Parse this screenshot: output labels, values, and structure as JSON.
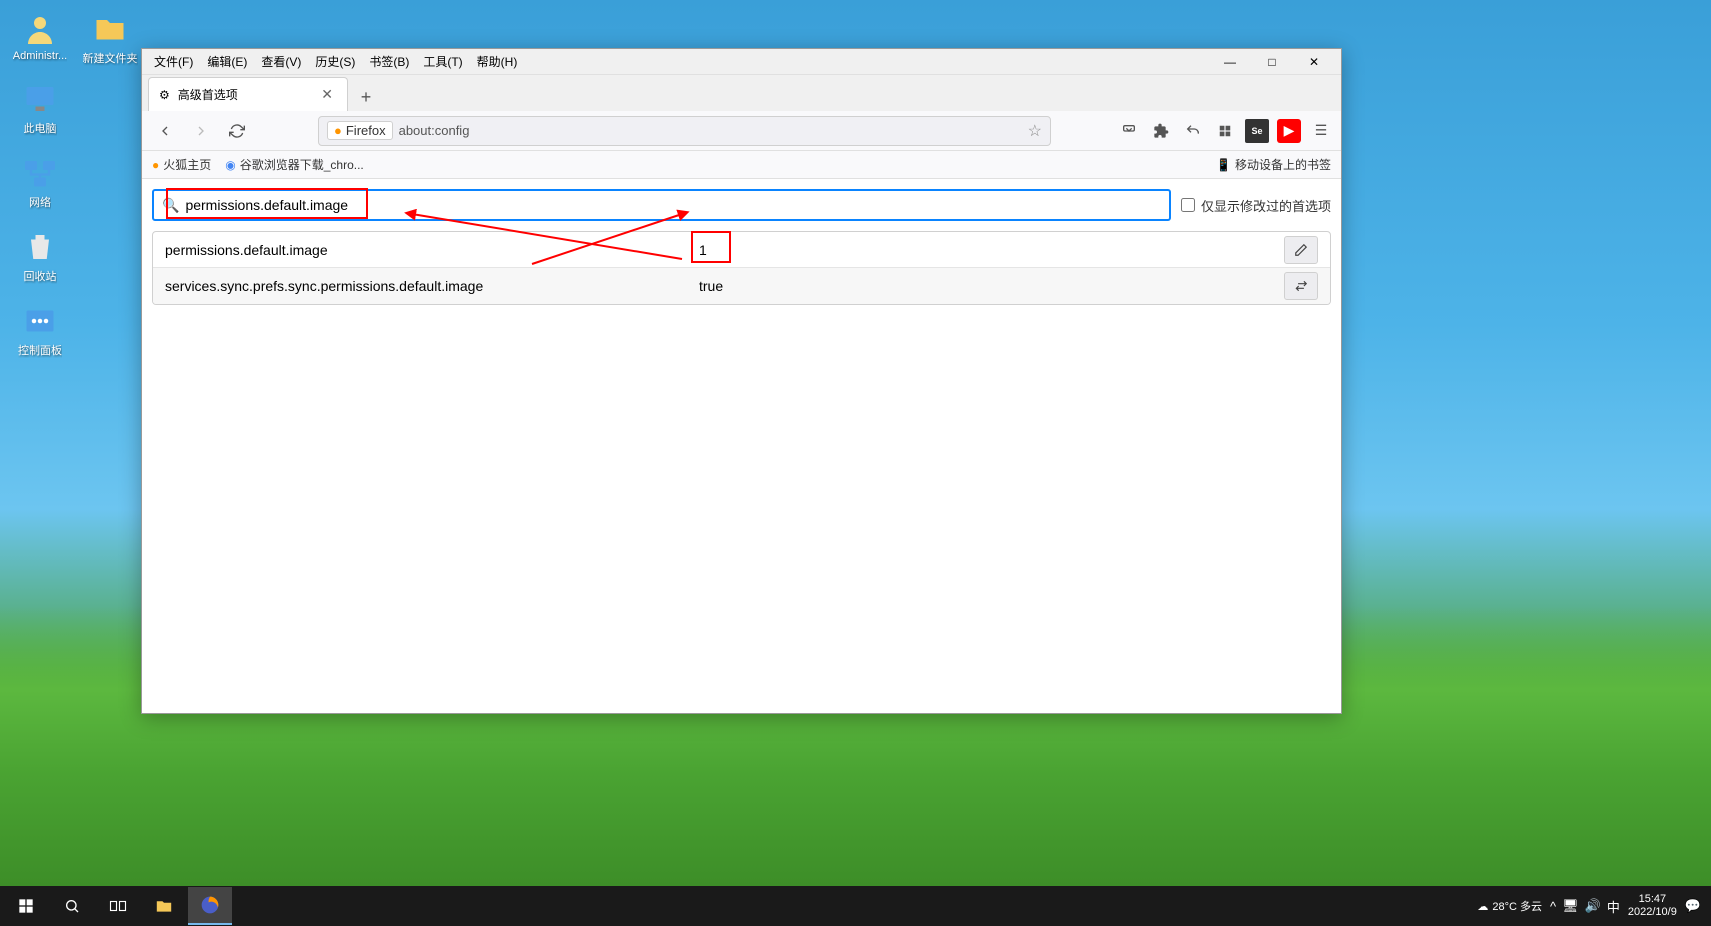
{
  "desktop": {
    "icons": [
      {
        "label": "Administr...",
        "icon": "user"
      },
      {
        "label": "此电脑",
        "icon": "pc"
      },
      {
        "label": "网络",
        "icon": "network"
      },
      {
        "label": "回收站",
        "icon": "recycle"
      },
      {
        "label": "控制面板",
        "icon": "control"
      }
    ],
    "icons_col2": [
      {
        "label": "新建文件夹",
        "icon": "folder"
      }
    ]
  },
  "window": {
    "menubar": [
      "文件(F)",
      "编辑(E)",
      "查看(V)",
      "历史(S)",
      "书签(B)",
      "工具(T)",
      "帮助(H)"
    ],
    "tab": {
      "title": "高级首选项"
    },
    "urlbar": {
      "identity": "Firefox",
      "url": "about:config"
    },
    "bookmarks": {
      "left": [
        "火狐主页",
        "谷歌浏览器下载_chro..."
      ],
      "right": "移动设备上的书签"
    }
  },
  "config": {
    "search_value": "permissions.default.image",
    "modified_only_label": "仅显示修改过的首选项",
    "rows": [
      {
        "name": "permissions.default.image",
        "value": "1",
        "action": "edit"
      },
      {
        "name": "services.sync.prefs.sync.permissions.default.image",
        "value": "true",
        "action": "toggle"
      }
    ]
  },
  "taskbar": {
    "weather": "28°C 多云",
    "ime": "中",
    "time": "15:47",
    "date": "2022/10/9"
  }
}
